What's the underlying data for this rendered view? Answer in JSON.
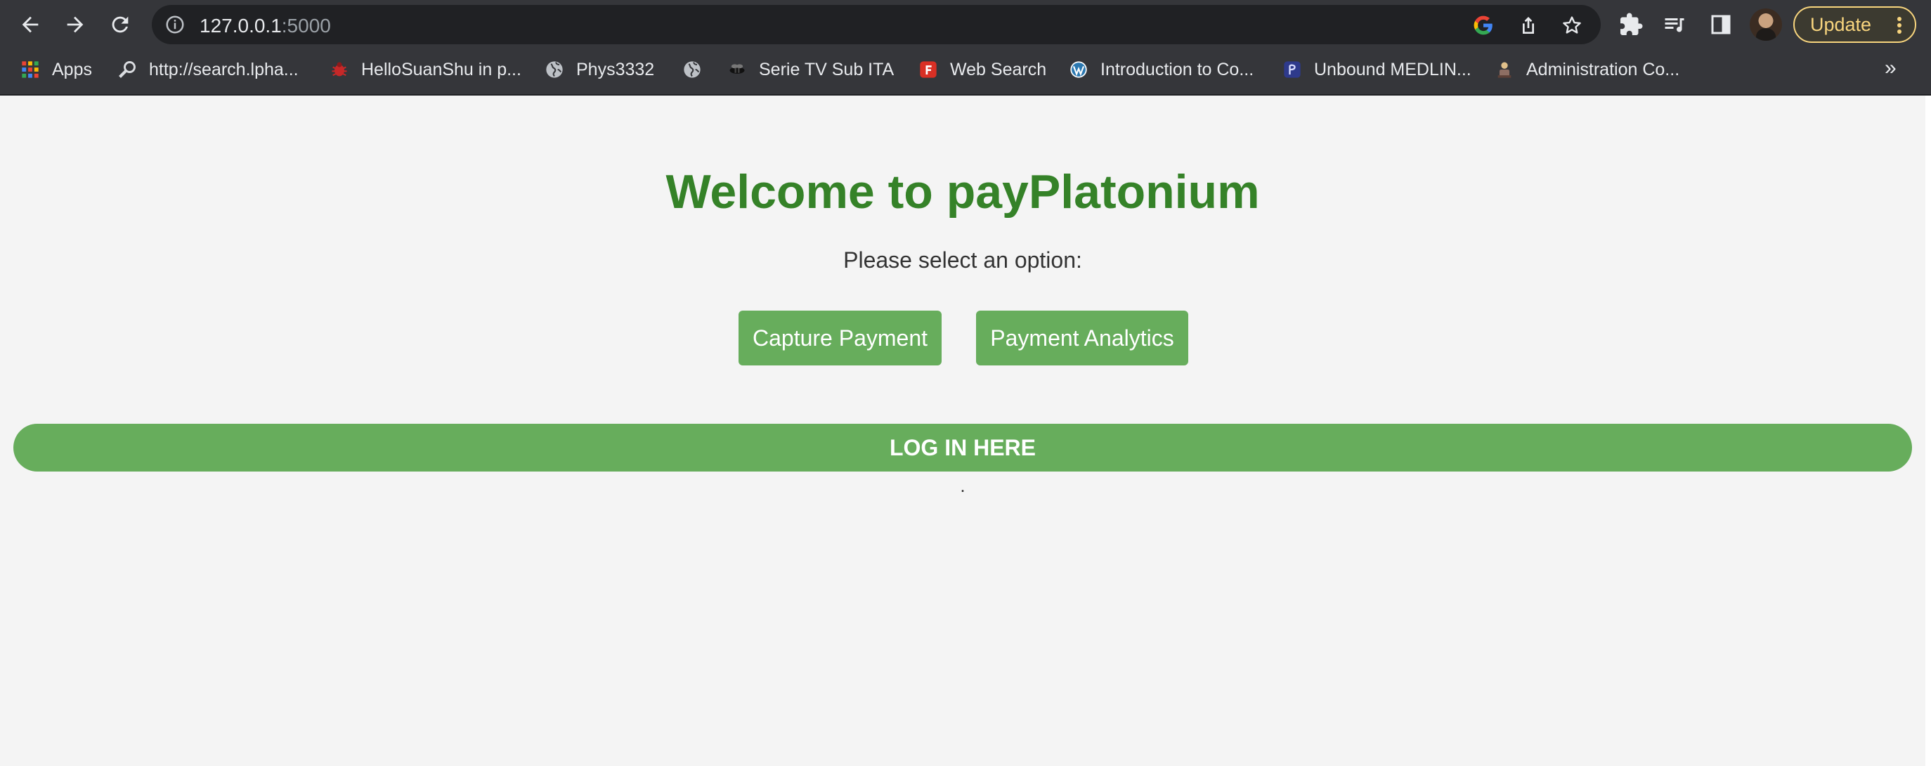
{
  "browser": {
    "url_host": "127.0.0.1",
    "url_port": ":5000",
    "update_label": "Update",
    "bookmarks": [
      {
        "label": "Apps",
        "icon": "apps-grid-icon"
      },
      {
        "label": "http://search.lpha...",
        "icon": "magnifier-icon"
      },
      {
        "label": "HelloSuanShu in p...",
        "icon": "bug-icon"
      },
      {
        "label": "Phys3332",
        "icon": "globe-icon"
      },
      {
        "label": "",
        "icon": "globe-icon"
      },
      {
        "label": "Serie TV Sub ITA",
        "icon": "bee-icon"
      },
      {
        "label": "Web Search",
        "icon": "f-logo-icon"
      },
      {
        "label": "Introduction to Co...",
        "icon": "wordpress-icon"
      },
      {
        "label": "Unbound MEDLIN...",
        "icon": "unbound-icon"
      },
      {
        "label": "Administration Co...",
        "icon": "admin-icon"
      }
    ],
    "more_label": "»"
  },
  "page": {
    "title": "Welcome to payPlatonium",
    "subtitle": "Please select an option:",
    "capture_label": "Capture Payment",
    "analytics_label": "Payment Analytics",
    "login_label": "LOG IN HERE",
    "footer_dot": "."
  },
  "colors": {
    "accent_green": "#67ad5c",
    "title_green": "#358228",
    "background": "#f4f4f4",
    "chrome": "#35363a"
  }
}
